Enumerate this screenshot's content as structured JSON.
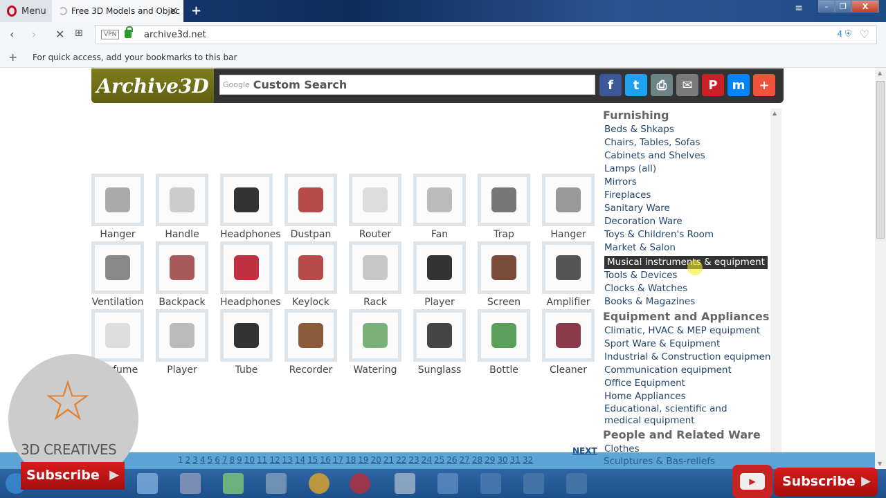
{
  "browser": {
    "menu_label": "Menu",
    "tab_title": "Free 3D Models and Objec",
    "url": "archive3d.net",
    "vpn_label": "VPN",
    "blocked_count": "4",
    "bookmarks_hint": "For quick access, add your bookmarks to this bar"
  },
  "site": {
    "logo": "Archive3D",
    "search_brand": "Google",
    "search_placeholder": "Custom Search",
    "social": [
      {
        "name": "facebook",
        "glyph": "f",
        "color": "#3b5998"
      },
      {
        "name": "twitter",
        "glyph": "t",
        "color": "#1da1f2"
      },
      {
        "name": "print",
        "glyph": "⎙",
        "color": "#6d8486"
      },
      {
        "name": "email",
        "glyph": "✉",
        "color": "#7b7b7b"
      },
      {
        "name": "pinterest",
        "glyph": "P",
        "color": "#cb2027"
      },
      {
        "name": "messenger",
        "glyph": "m",
        "color": "#0084ff"
      },
      {
        "name": "more",
        "glyph": "+",
        "color": "#f0523b"
      }
    ]
  },
  "models": [
    {
      "label": "Hanger",
      "color": "#aaa"
    },
    {
      "label": "Handle",
      "color": "#ccc"
    },
    {
      "label": "Headphones",
      "color": "#333"
    },
    {
      "label": "Dustpan",
      "color": "#b74a4a"
    },
    {
      "label": "Router",
      "color": "#ddd"
    },
    {
      "label": "Fan",
      "color": "#bbb"
    },
    {
      "label": "Trap",
      "color": "#777"
    },
    {
      "label": "Hanger",
      "color": "#999"
    },
    {
      "label": "Ventilation",
      "color": "#888"
    },
    {
      "label": "Backpack",
      "color": "#a85a5a"
    },
    {
      "label": "Headphones",
      "color": "#c03040"
    },
    {
      "label": "Keylock",
      "color": "#b94a4a"
    },
    {
      "label": "Rack",
      "color": "#c8c8c8"
    },
    {
      "label": "Player",
      "color": "#333"
    },
    {
      "label": "Screen",
      "color": "#7a4a3a"
    },
    {
      "label": "Amplifier",
      "color": "#555"
    },
    {
      "label": "Perfume",
      "color": "#ddd"
    },
    {
      "label": "Player",
      "color": "#bbb"
    },
    {
      "label": "Tube",
      "color": "#333"
    },
    {
      "label": "Recorder",
      "color": "#8a5a3a"
    },
    {
      "label": "Watering",
      "color": "#7ab07a"
    },
    {
      "label": "Sunglass",
      "color": "#444"
    },
    {
      "label": "Bottle",
      "color": "#5aa05a"
    },
    {
      "label": "Cleaner",
      "color": "#8a3a4a"
    }
  ],
  "sidebar": {
    "groups": [
      {
        "title": "Furnishing",
        "items": [
          "Beds & Shkaps",
          "Chairs, Tables, Sofas",
          "Cabinets and Shelves",
          "Lamps (all)",
          "Mirrors",
          "Fireplaces",
          "Sanitary Ware",
          "Decoration Ware",
          "Toys & Children's Room",
          "Market & Salon",
          "Musical instruments & equipment",
          "Tools & Devices",
          "Clocks & Watches",
          "Books & Magazines"
        ]
      },
      {
        "title": "Equipment and Appliances",
        "items": [
          "Climatic, HVAC & MEP equipment",
          "Sport Ware & Equipment",
          "Industrial & Construction equipment",
          "Communication equipment",
          "Office Equipment",
          "Home Appliances",
          "Educational, scientific and medical equipment"
        ]
      },
      {
        "title": "People and Related Ware",
        "items": [
          "Clothes"
        ]
      }
    ],
    "hovered_item": "Musical instruments & equipment",
    "partial_item": "Sculptures & Bas-reliefs"
  },
  "pagination": {
    "current": "1",
    "pages": [
      "1",
      "2",
      "3",
      "4",
      "5",
      "6",
      "7",
      "8",
      "9",
      "10",
      "11",
      "12",
      "13",
      "14",
      "15",
      "16",
      "17",
      "18",
      "19",
      "20",
      "21",
      "22",
      "23",
      "24",
      "25",
      "26",
      "27",
      "28",
      "29",
      "30",
      "31",
      "32"
    ],
    "next_label": "NEXT"
  },
  "overlay": {
    "brand": "3D CREATIVES",
    "subscribe_label": "Subscribe"
  }
}
